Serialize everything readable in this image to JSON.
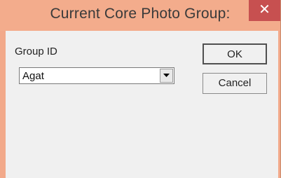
{
  "window": {
    "title": "Current Core Photo Group:",
    "close_symbol": "✕"
  },
  "form": {
    "group_id_label": "Group ID",
    "group_id_value": "Agat"
  },
  "buttons": {
    "ok_label": "OK",
    "cancel_label": "Cancel"
  },
  "icons": {
    "close": "close-icon",
    "dropdown": "chevron-down-icon"
  },
  "colors": {
    "titlebar": "#f3ac8c",
    "close_button": "#c75050",
    "client_background": "#f0f0f0"
  }
}
